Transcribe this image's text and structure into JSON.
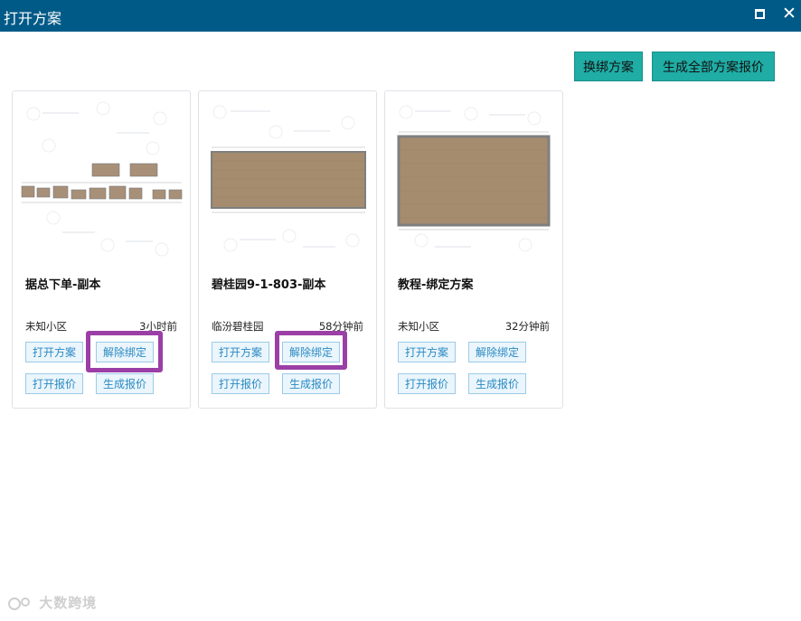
{
  "window": {
    "title": "打开方案",
    "maximize_icon": "maximize-icon",
    "close_icon": "close-icon",
    "close_glyph": "✕"
  },
  "toolbar": {
    "rebind_label": "换绑方案",
    "generate_all_label": "生成全部方案报价",
    "button_color": "#1fada5"
  },
  "cards": [
    {
      "name": "据总下单-副本",
      "community": "未知小区",
      "time": "3小时前",
      "open_plan": "打开方案",
      "unbind": "解除绑定",
      "open_quote": "打开报价",
      "gen_quote": "生成报价"
    },
    {
      "name": "碧桂园9-1-803-副本",
      "community": "临汾碧桂园",
      "time": "58分钟前",
      "open_plan": "打开方案",
      "unbind": "解除绑定",
      "open_quote": "打开报价",
      "gen_quote": "生成报价"
    },
    {
      "name": "教程-绑定方案",
      "community": "未知小区",
      "time": "32分钟前",
      "open_plan": "打开方案",
      "unbind": "解除绑定",
      "open_quote": "打开报价",
      "gen_quote": "生成报价"
    }
  ],
  "highlight_color": "#9b3fa6",
  "footer": {
    "logo_icon": "kujiale-logo-icon",
    "brand": "大数跨境"
  }
}
